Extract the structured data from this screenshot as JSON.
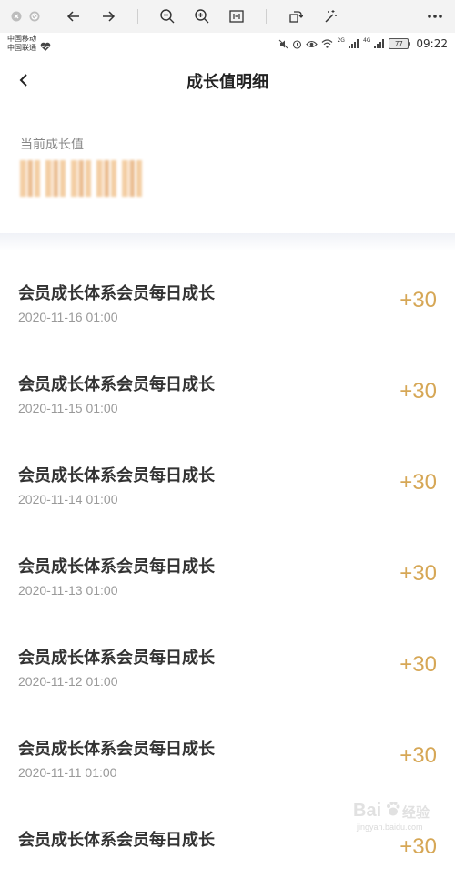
{
  "viewer_toolbar": {
    "icons": [
      "close-circle-icon",
      "block-icon",
      "arrow-left-icon",
      "arrow-right-icon",
      "zoom-out-icon",
      "zoom-in-icon",
      "fit-screen-icon",
      "rotate-icon",
      "magic-wand-icon",
      "more-icon"
    ]
  },
  "status_bar": {
    "carrier1": "中国移动",
    "carrier2": "中国联通",
    "signal_label_1": "2G",
    "signal_label_2": "4G",
    "battery": "77",
    "time": "09:22"
  },
  "header": {
    "title": "成长值明细"
  },
  "growth": {
    "label": "当前成长值"
  },
  "records": [
    {
      "title": "会员成长体系会员每日成长",
      "time": "2020-11-16 01:00",
      "points": "+30"
    },
    {
      "title": "会员成长体系会员每日成长",
      "time": "2020-11-15 01:00",
      "points": "+30"
    },
    {
      "title": "会员成长体系会员每日成长",
      "time": "2020-11-14 01:00",
      "points": "+30"
    },
    {
      "title": "会员成长体系会员每日成长",
      "time": "2020-11-13 01:00",
      "points": "+30"
    },
    {
      "title": "会员成长体系会员每日成长",
      "time": "2020-11-12 01:00",
      "points": "+30"
    },
    {
      "title": "会员成长体系会员每日成长",
      "time": "2020-11-11 01:00",
      "points": "+30"
    },
    {
      "title": "会员成长体系会员每日成长",
      "time": "",
      "points": "+30"
    }
  ],
  "watermark": {
    "brand": "Bai",
    "brand_cn": "经验",
    "url": "jingyan.baidu.com"
  },
  "colors": {
    "accent": "#d6a756",
    "muted": "#999999"
  }
}
